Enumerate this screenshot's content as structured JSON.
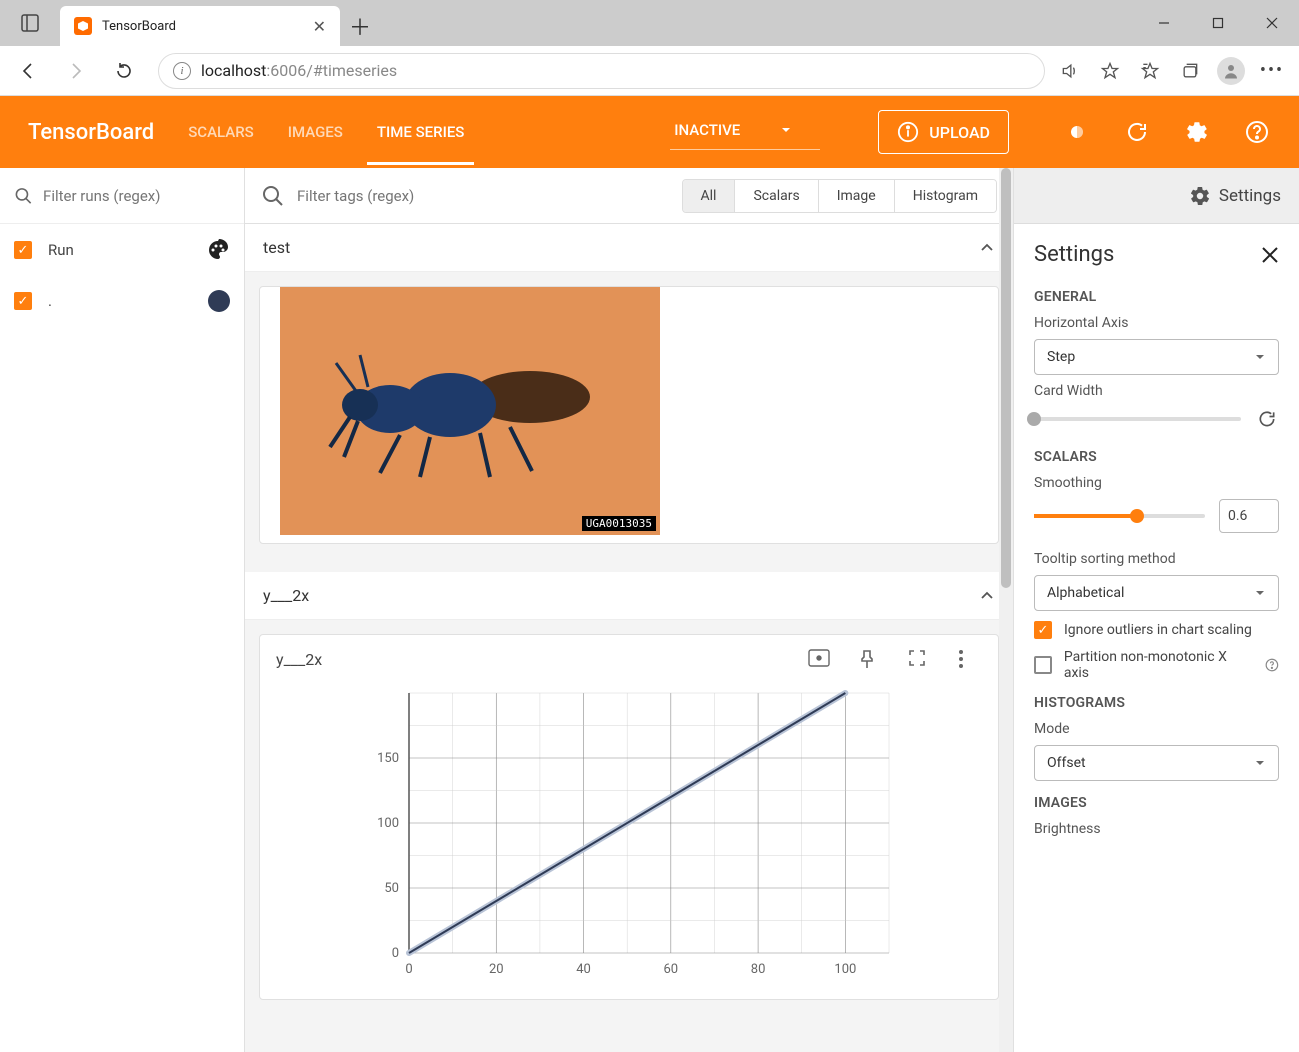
{
  "browser": {
    "tab_title": "TensorBoard",
    "url_host": "localhost",
    "url_rest": ":6006/#timeseries"
  },
  "header": {
    "logo": "TensorBoard",
    "tabs": [
      "SCALARS",
      "IMAGES",
      "TIME SERIES"
    ],
    "active_tab": 2,
    "status": "INACTIVE",
    "upload": "UPLOAD"
  },
  "runs": {
    "filter_placeholder": "Filter runs (regex)",
    "items": [
      {
        "name": "Run",
        "checked": true,
        "swatch": "palette"
      },
      {
        "name": ".",
        "checked": true,
        "swatch": "#2f3b56"
      }
    ]
  },
  "center": {
    "tag_filter_placeholder": "Filter tags (regex)",
    "toggles": [
      "All",
      "Scalars",
      "Image",
      "Histogram"
    ],
    "active_toggle": 0,
    "groups": [
      {
        "title": "test",
        "type": "image",
        "image_tag": "UGA0013035"
      },
      {
        "title": "y___2x",
        "type": "line",
        "card_title": "y___2x"
      }
    ]
  },
  "chart_data": {
    "type": "line",
    "title": "y___2x",
    "xlabel": "",
    "ylabel": "",
    "xlim": [
      0,
      110
    ],
    "ylim": [
      0,
      200
    ],
    "x_ticks": [
      0,
      20,
      40,
      60,
      80,
      100
    ],
    "y_ticks": [
      0,
      50,
      100,
      150
    ],
    "series": [
      {
        "name": "y___2x",
        "color": "#2f3b56",
        "x": [
          0,
          20,
          40,
          60,
          80,
          100
        ],
        "values": [
          0,
          40,
          80,
          120,
          160,
          200
        ]
      }
    ]
  },
  "settings": {
    "toggle_label": "Settings",
    "title": "Settings",
    "general_label": "GENERAL",
    "horizontal_axis_label": "Horizontal Axis",
    "horizontal_axis_value": "Step",
    "card_width_label": "Card Width",
    "card_width_pct": 0,
    "scalars_label": "SCALARS",
    "smoothing_label": "Smoothing",
    "smoothing_value": "0.6",
    "smoothing_pct": 60,
    "tooltip_label": "Tooltip sorting method",
    "tooltip_value": "Alphabetical",
    "ignore_outliers_label": "Ignore outliers in chart scaling",
    "ignore_outliers": true,
    "partition_label": "Partition non-monotonic X axis",
    "partition": false,
    "histograms_label": "HISTOGRAMS",
    "mode_label": "Mode",
    "mode_value": "Offset",
    "images_label": "IMAGES",
    "brightness_label": "Brightness"
  }
}
